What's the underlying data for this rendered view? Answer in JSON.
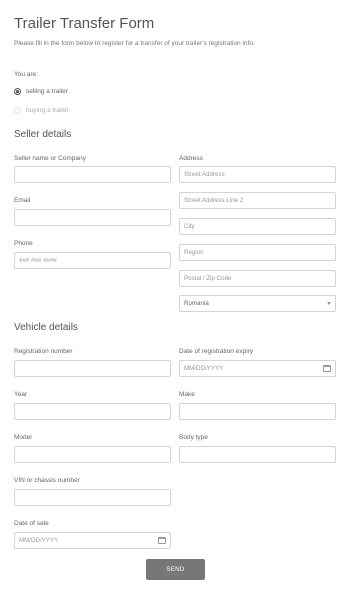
{
  "header": {
    "title": "Trailer Transfer Form",
    "subtitle": "Please fill in the form below to register for a transfer of your trailer's registration info."
  },
  "role": {
    "label": "You are:",
    "options": [
      "selling a trailer",
      "buying a trailer"
    ],
    "selected": "selling a trailer"
  },
  "seller": {
    "heading": "Seller details",
    "name_label": "Seller name or Company",
    "email_label": "Email",
    "phone_label": "Phone",
    "phone_placeholder": "### ### ####",
    "address_label": "Address",
    "street_placeholder": "Street Address",
    "street2_placeholder": "Street Address Line 2",
    "city_placeholder": "City",
    "region_placeholder": "Region",
    "postal_placeholder": "Postal / Zip Code",
    "country_value": "Romania"
  },
  "vehicle": {
    "heading": "Vehicle details",
    "registration_label": "Registration number",
    "expiry_label": "Date of registration expiry",
    "expiry_placeholder": "MM/DD/YYYY",
    "year_label": "Year",
    "make_label": "Make",
    "model_label": "Model",
    "body_label": "Body type",
    "vin_label": "VIN or chassis number",
    "sale_label": "Date of sale",
    "sale_placeholder": "MM/DD/YYYY"
  },
  "submit_label": "SEND",
  "colors": {
    "button": "#777777",
    "border": "#d4d4d4",
    "text": "#555555"
  }
}
